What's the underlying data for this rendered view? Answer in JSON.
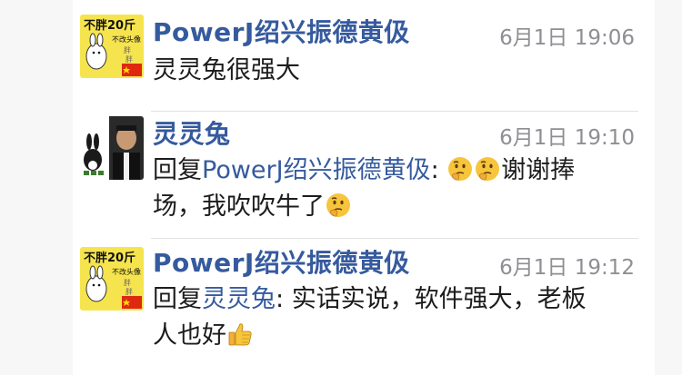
{
  "comments": [
    {
      "author": "PowerJ绍兴振德黄伋",
      "time": "6月1日 19:06",
      "avatar_text_top": "不胖20斤",
      "avatar_text_right": "不改头像",
      "avatar_small": "胖",
      "text": "灵灵兔很强大"
    },
    {
      "author": "灵灵兔",
      "time": "6月1日 19:10",
      "reply_prefix": "回复",
      "reply_to": "PowerJ绍兴振德黄伋",
      "reply_sep": ": ",
      "text_line1": "谢谢捧",
      "text_line2": "场，我吹吹牛了",
      "emojis": [
        "thinking-face-icon",
        "thinking-face-icon",
        "thinking-face-icon"
      ]
    },
    {
      "author": "PowerJ绍兴振德黄伋",
      "time": "6月1日 19:12",
      "avatar_text_top": "不胖20斤",
      "avatar_text_right": "不改头像",
      "avatar_small": "胖",
      "reply_prefix": "回复",
      "reply_to": "灵灵兔",
      "reply_sep": ": ",
      "text_line1": "实话实说，软件强大，老板",
      "text_line2": "人也好",
      "emojis": [
        "thumbs-up-icon"
      ]
    }
  ],
  "colors": {
    "link": "#355a9e",
    "time": "#8e8e93",
    "text": "#1c1c1c",
    "avatar_yellow": "#f6e44e"
  }
}
